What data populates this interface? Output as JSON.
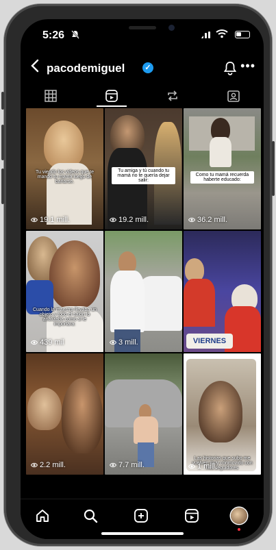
{
  "status_bar": {
    "time": "5:26"
  },
  "profile": {
    "username": "pacodemiguel"
  },
  "tabs": [
    "grid",
    "reels",
    "reposts",
    "tagged"
  ],
  "reels": [
    {
      "caption": "Tu viendo los videos que te mandó tu mamá luego de bañarse.",
      "views": "19.1 mill."
    },
    {
      "caption": "Tu amiga y tú cuando tu mamá no te quería dejar salir:",
      "views": "19.2 mill."
    },
    {
      "caption": "Como tu mamá recuerda haberte educado:",
      "views": "36.2 mill."
    },
    {
      "caption": "Cuando la maestra llevaba un objeto y todo el salón lo analizaba como si le importara:",
      "views": "439 mil"
    },
    {
      "caption": "",
      "views": "3 mill."
    },
    {
      "caption": "VIERNES",
      "views": ""
    },
    {
      "caption": "",
      "views": "2.2 mill."
    },
    {
      "caption": "",
      "views": "7.7 mill."
    },
    {
      "caption": "Las historias que subo me vuelven muy conmovido con mis seguidores",
      "views": "1 mill."
    }
  ],
  "nav": [
    "home",
    "search",
    "create",
    "reels",
    "profile"
  ]
}
